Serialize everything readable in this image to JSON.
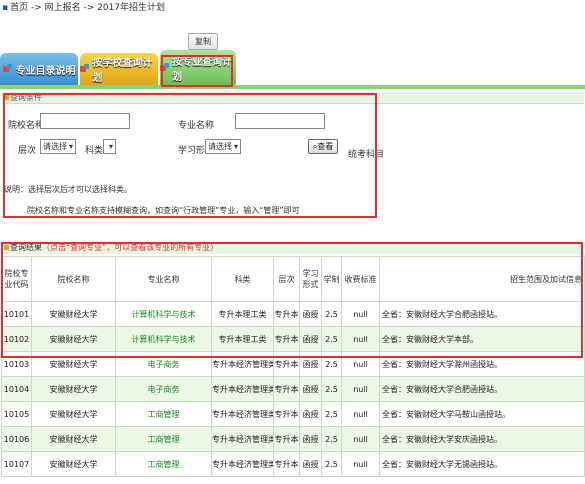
{
  "breadcrumb": "首页 -> 网上报名 -> 2017年招生计划",
  "copy_button": "复制",
  "tabs": [
    "专业目录说明",
    "按学校查询计划",
    "按专业查询计划"
  ],
  "query_panel": {
    "title": "查询条件",
    "school_label": "院校名称",
    "major_label": "专业名称",
    "level_label": "层次",
    "level_value": "请选择",
    "subject_label": "科类",
    "study_mode_label": "学习形式",
    "study_mode_value": "请选择",
    "search_button": "查看",
    "exam_subjects": "统考科目",
    "note_line1": "说明：选择层次后才可以选择科类。",
    "note_line2": "院校名称和专业名称支持模糊查询，如查询“行政管理”专业，输入“管理”即可"
  },
  "results": {
    "title": "查询结果",
    "hint": "（点击“查询专业”，可以查看该专业的所有专业）",
    "columns": [
      "院校专业代码",
      "院校名称",
      "专业名称",
      "科类",
      "层次",
      "学习形式",
      "学制",
      "收费标准",
      "招生范围及加试信息"
    ],
    "rows": [
      {
        "code": "10101",
        "school": "安徽财经大学",
        "major": "计算机科学与技术",
        "subject": "专升本理工类",
        "level": "专升本",
        "mode": "函授",
        "years": "2.5",
        "fee": "null",
        "scope": "全省：安徽财经大学合肥函授站。"
      },
      {
        "code": "10102",
        "school": "安徽财经大学",
        "major": "计算机科学与技术",
        "subject": "专升本理工类",
        "level": "专升本",
        "mode": "函授",
        "years": "2.5",
        "fee": "null",
        "scope": "全省：安徽财经大学本部。"
      },
      {
        "code": "10103",
        "school": "安徽财经大学",
        "major": "电子商务",
        "subject": "专升本经济管理类",
        "level": "专升本",
        "mode": "函授",
        "years": "2.5",
        "fee": "null",
        "scope": "全省：安徽财经大学滁州函授站。"
      },
      {
        "code": "10104",
        "school": "安徽财经大学",
        "major": "电子商务",
        "subject": "专升本经济管理类",
        "level": "专升本",
        "mode": "函授",
        "years": "2.5",
        "fee": "null",
        "scope": "全省：安徽财经大学合肥函授站。"
      },
      {
        "code": "10105",
        "school": "安徽财经大学",
        "major": "工商管理",
        "subject": "专升本经济管理类",
        "level": "专升本",
        "mode": "函授",
        "years": "2.5",
        "fee": "null",
        "scope": "全省：安徽财经大学马鞍山函授站。"
      },
      {
        "code": "10106",
        "school": "安徽财经大学",
        "major": "工商管理",
        "subject": "专升本经济管理类",
        "level": "专升本",
        "mode": "函授",
        "years": "2.5",
        "fee": "null",
        "scope": "全省：安徽财经大学安庆函授站。"
      },
      {
        "code": "10107",
        "school": "安徽财经大学",
        "major": "工商管理",
        "subject": "专升本经济管理类",
        "level": "专升本",
        "mode": "函授",
        "years": "2.5",
        "fee": "null",
        "scope": "全省：安徽财经大学无锡函授站。"
      }
    ]
  },
  "colors": {
    "highlight_border": "#e03030",
    "tab_bar": "#8fcf7a",
    "major_link": "#1a8a1a"
  }
}
